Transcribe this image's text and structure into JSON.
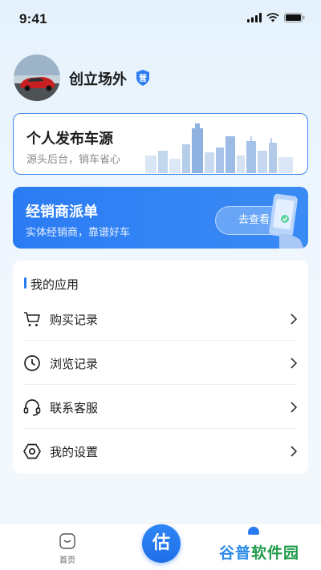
{
  "status_bar": {
    "time": "9:41"
  },
  "profile": {
    "name": "创立场外",
    "badge": "营"
  },
  "personal_card": {
    "title": "个人发布车源",
    "subtitle": "源头后台，销车省心"
  },
  "dealer_card": {
    "title": "经销商派单",
    "subtitle": "实体经销商，靠谱好车",
    "button": "去查看"
  },
  "apps": {
    "title": "我的应用",
    "items": [
      {
        "label": "购买记录",
        "icon": "cart-icon"
      },
      {
        "label": "浏览记录",
        "icon": "clock-icon"
      },
      {
        "label": "联系客服",
        "icon": "headset-icon"
      },
      {
        "label": "我的设置",
        "icon": "settings-icon"
      }
    ]
  },
  "tab_bar": {
    "home_label": "首页",
    "center_label": "估"
  },
  "watermark": {
    "text": "谷普软件园"
  },
  "colors": {
    "accent": "#2b7cf3",
    "card_border": "#3a86f0"
  }
}
